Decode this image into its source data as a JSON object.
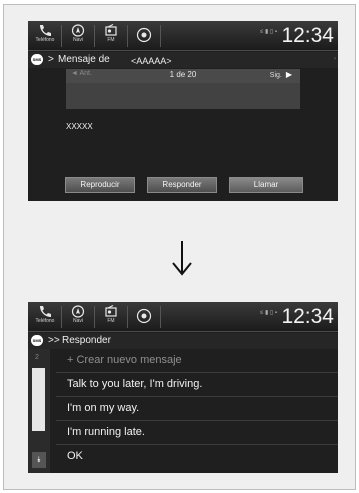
{
  "status_bar": {
    "phone_label": "Teléfono",
    "navi_label": "Navi",
    "fm_label": "FM",
    "clock": "12:34",
    "signal_text": "≤ ▮ ▯ ▪"
  },
  "screen1": {
    "title": "Mensaje de",
    "sender": "<AAAAA>",
    "page_indicator": "1 de 20",
    "prev_label": "◄ Ant.",
    "next_label": "Sig.",
    "message_body": "XXXXX",
    "buttons": {
      "play": "Reproducir",
      "reply": "Responder",
      "call": "Llamar"
    }
  },
  "screen2": {
    "title": "Responder",
    "scroll_number": "2",
    "items": [
      "+ Crear nuevo mensaje",
      "Talk to you later, I'm driving.",
      "I'm on my way.",
      "I'm running late.",
      "OK"
    ]
  },
  "colors": {
    "screen_bg": "#1f1f1f",
    "highlight_button": "#6a6a6a",
    "frame_bg": "#efefef"
  },
  "icons": {
    "phone": "phone-icon",
    "navi": "navi-icon",
    "fm": "radio-icon",
    "audio": "audio-icon",
    "sms": "sms-icon",
    "arrow": "down-arrow-icon"
  }
}
